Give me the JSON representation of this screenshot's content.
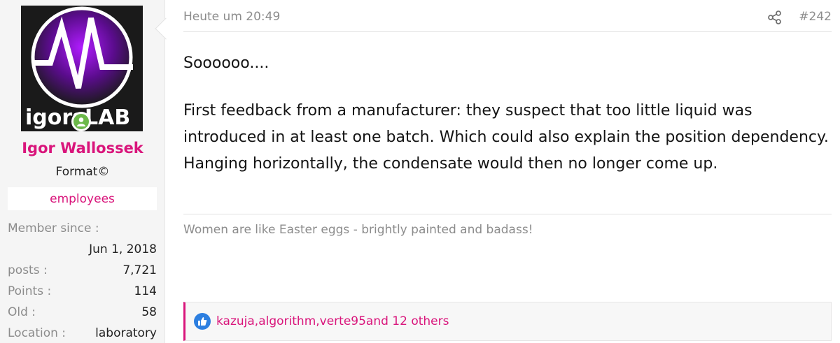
{
  "user": {
    "avatar_logo_text": "igorsLAB",
    "name": "Igor Wallossek",
    "title": "Format©",
    "banner": "employees",
    "member_since_label": "Member since :",
    "member_since_value": "Jun 1, 2018",
    "stats": [
      {
        "label": "posts :",
        "value": "7,721"
      },
      {
        "label": "Points :",
        "value": "114"
      },
      {
        "label": "Old :",
        "value": "58"
      },
      {
        "label": "Location :",
        "value": "laboratory"
      }
    ]
  },
  "post": {
    "date": "Heute um 20:49",
    "number": "#242",
    "body_line1": "Soooooo....",
    "body_paragraph": "First feedback from a manufacturer: they suspect that too little liquid was introduced in at least one batch. Which could also explain the position dependency. Hanging horizontally, the condensate would then no longer come up.",
    "signature": "Women are like Easter eggs - brightly painted and badass!",
    "reactions": "kazuja,algorithm,verte95and 12 others"
  },
  "colors": {
    "accent": "#d9157b",
    "online": "#6cb94a",
    "like": "#2d7fe0"
  },
  "icons": [
    "share-icon",
    "like-icon",
    "online-status-icon"
  ]
}
